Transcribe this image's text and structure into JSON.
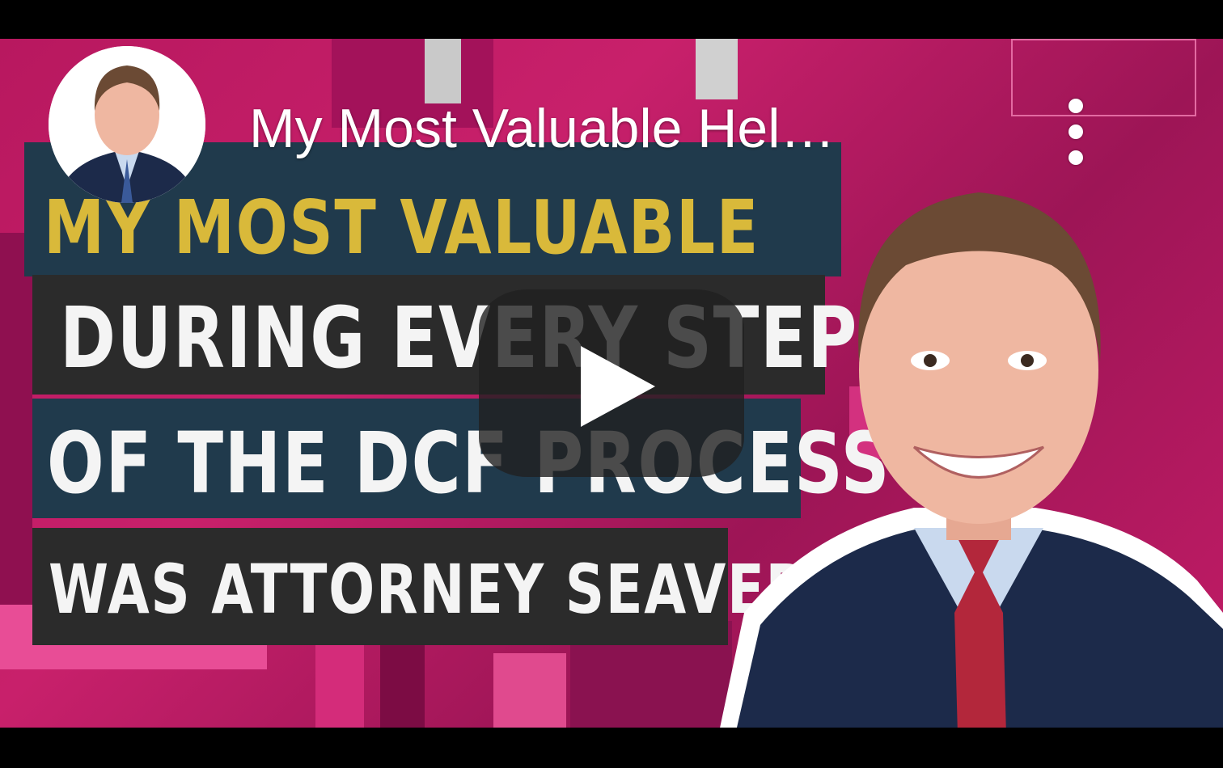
{
  "video": {
    "title": "My Most Valuable Hel…",
    "channel_avatar_icon": "channel-avatar",
    "more_icon": "vertical-dots-icon",
    "play_icon": "play-icon"
  },
  "thumbnail": {
    "line1": "MY MOST VALUABLE",
    "line2": "DURING EVERY STEP",
    "line3": "OF THE DCF PROCESS",
    "line4": "WAS ATTORNEY SEAVER"
  },
  "colors": {
    "background_magenta": "#c21c66",
    "banner_navy": "#203a4c",
    "banner_dark": "#2b2b2b",
    "headline_gold": "#d9b93a",
    "text_white": "#f4f4f4",
    "play_button": "#212121"
  }
}
